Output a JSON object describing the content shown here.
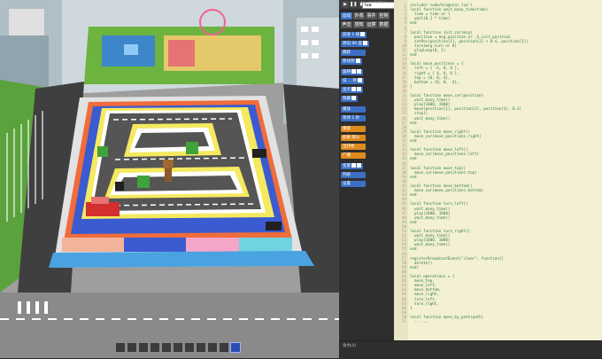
{
  "toolbar": {
    "run": "▶",
    "pause": "❚❚",
    "stop": "■",
    "file": "文件",
    "lang_value": "lua",
    "help": "?",
    "blocks": "积",
    "code": "码"
  },
  "palette": {
    "tabs": [
      "运动",
      "外观",
      "事件",
      "控制",
      "声音",
      "感知",
      "运算",
      "数据"
    ],
    "blocks": [
      "前进 1 格",
      "转向 90 度",
      "跳跃",
      "移动到",
      "面朝",
      "说 ... 秒",
      "显示",
      "隐藏",
      "播放",
      "等待 1 秒",
      "重复",
      "如果 那么",
      "当开始",
      "广播",
      "变量",
      "列表",
      "设置"
    ]
  },
  "code": {
    "lines": [
      "include('code/blagncar.lua')",
      "local function wait_many_time(time)",
      "  time = time or 1",
      "  wait(0.1 * time)",
      "end",
      "",
      "local function init_car(msg)",
      "  position = msg.position or _G.init_position",
      "  setPos(position[1], position[2] + 0.4, position[3])",
      "  turn(msg.turn or 0)",
      "  playLoop(0, 1)",
      "end",
      "",
      "local move_positions = {",
      "  left = { -4, 0, 0 },",
      "  right = { 4, 0, 0 },",
      "  top = {0, 0, 4},",
      "  bottom = {0, 0, -4},",
      "}",
      "",
      "local function move_car(position)",
      "  wait_many_time()",
      "  play(1000, 1000)",
      "  move(position[1], position[2], position[3], 0.3)",
      "  stop()",
      "  wait_many_time()",
      "end",
      "",
      "local function move_right()",
      "  move_car(move_positions.right)",
      "end",
      "",
      "local function move_left()",
      "  move_car(move_positions.left)",
      "end",
      "",
      "local function move_top()",
      "  move_car(move_positions.top)",
      "end",
      "",
      "local function move_bottom()",
      "  move_car(move_positions.bottom)",
      "end",
      "",
      "local function turn_left()",
      "  wait_many_time()",
      "  play(1000, 1000)",
      "  wait_many_time()",
      "end",
      "",
      "local function turn_right()",
      "  wait_many_time()",
      "  play(1000, 1000)",
      "  wait_many_time()",
      "end",
      "",
      "registerBroadcastEvent(\"clear\", function()",
      "  delete()",
      "end)",
      "",
      "local operations = {",
      "  move_top,",
      "  move_left,",
      "  move_bottom,",
      "  move_right,",
      "  turn_left,",
      "  turn_right,",
      "}",
      "",
      "local function move_by_path(path)",
      "  -- ..."
    ]
  },
  "status": "角色(0)",
  "colors": {
    "editor_bg": "#f3f0d4",
    "code_text": "#2f7d3a",
    "palette_blue": "#3a6fc4",
    "palette_orange": "#e08a1e",
    "toolbar_green": "#3ca24a"
  }
}
